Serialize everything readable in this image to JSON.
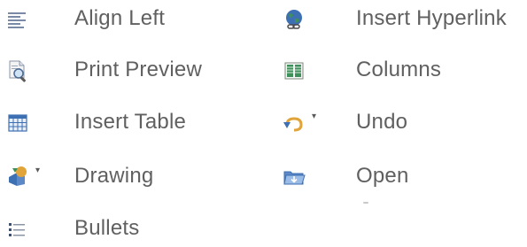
{
  "commands": {
    "align_left": {
      "label": "Align Left",
      "icon": "align-left-icon"
    },
    "print_preview": {
      "label": "Print Preview",
      "icon": "print-preview-icon"
    },
    "insert_table": {
      "label": "Insert Table",
      "icon": "insert-table-icon"
    },
    "drawing": {
      "label": "Drawing",
      "icon": "drawing-icon",
      "has_dropdown": true,
      "dropdown_glyph": "▾"
    },
    "bullets": {
      "label": "Bullets",
      "icon": "bullets-icon"
    },
    "insert_hyperlink": {
      "label": "Insert Hyperlink",
      "icon": "hyperlink-globe-icon"
    },
    "columns": {
      "label": "Columns",
      "icon": "columns-icon"
    },
    "undo": {
      "label": "Undo",
      "icon": "undo-icon",
      "has_dropdown": true,
      "dropdown_glyph": "▾"
    },
    "open": {
      "label": "Open",
      "icon": "open-folder-icon"
    }
  },
  "colors": {
    "text": "#606060",
    "background": "#ffffff",
    "accent_blue": "#3d6fb3",
    "accent_green": "#3e8f5a",
    "accent_orange": "#e0a43a"
  }
}
